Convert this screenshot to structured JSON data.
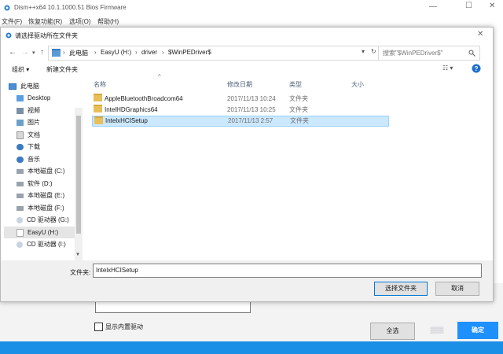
{
  "app": {
    "title": "Dism++x64 10.1.1000.51 Bios Firmware",
    "menu": [
      "文件(F)",
      "恢复功能(R)",
      "选项(O)",
      "帮助(H)"
    ]
  },
  "dialog": {
    "title": "请选择驱动所在文件夹",
    "breadcrumb": [
      "此电脑",
      "EasyU (H:)",
      "driver",
      "$WinPEDriver$"
    ],
    "search_placeholder": "搜索\"$WinPEDriver$\"",
    "toolbar": {
      "organize": "组织 ▾",
      "new_folder": "新建文件夹"
    },
    "nav_tree": [
      {
        "label": "此电脑",
        "icon": "computer-icon"
      },
      {
        "label": "Desktop",
        "icon": "desktop-folder-icon"
      },
      {
        "label": "视频",
        "icon": "video-folder-icon"
      },
      {
        "label": "图片",
        "icon": "picture-folder-icon"
      },
      {
        "label": "文档",
        "icon": "document-folder-icon"
      },
      {
        "label": "下载",
        "icon": "download-folder-icon"
      },
      {
        "label": "音乐",
        "icon": "music-folder-icon"
      },
      {
        "label": "本地磁盘 (C:)",
        "icon": "drive-icon"
      },
      {
        "label": "软件 (D:)",
        "icon": "drive-icon"
      },
      {
        "label": "本地磁盘 (E:)",
        "icon": "drive-icon"
      },
      {
        "label": "本地磁盘 (F:)",
        "icon": "drive-icon"
      },
      {
        "label": "CD 驱动器 (G:)",
        "icon": "cd-drive-icon"
      },
      {
        "label": "EasyU (H:)",
        "icon": "usb-drive-icon"
      },
      {
        "label": "CD 驱动器 (I:)",
        "icon": "cd-drive-icon"
      }
    ],
    "columns": {
      "name": "名称",
      "date": "修改日期",
      "type": "类型",
      "size": "大小"
    },
    "files": [
      {
        "name": "AppleBluetoothBroadcom64",
        "date": "2017/11/13 10:24",
        "type": "文件夹"
      },
      {
        "name": "IntelHDGraphics64",
        "date": "2017/11/13 10:25",
        "type": "文件夹"
      },
      {
        "name": "IntelxHCISetup",
        "date": "2017/11/13 2:57",
        "type": "文件夹"
      }
    ],
    "folder_label": "文件夹:",
    "folder_value": "IntelxHCISetup",
    "select_button": "选择文件夹",
    "cancel_button": "取消"
  },
  "background": {
    "show_builtin": "显示内置驱动",
    "select_all": "全选",
    "ok_button": "确定"
  },
  "colors": {
    "accent": "#0078d7",
    "selection": "#cce8ff",
    "taskbar": "#1b8fe6"
  }
}
